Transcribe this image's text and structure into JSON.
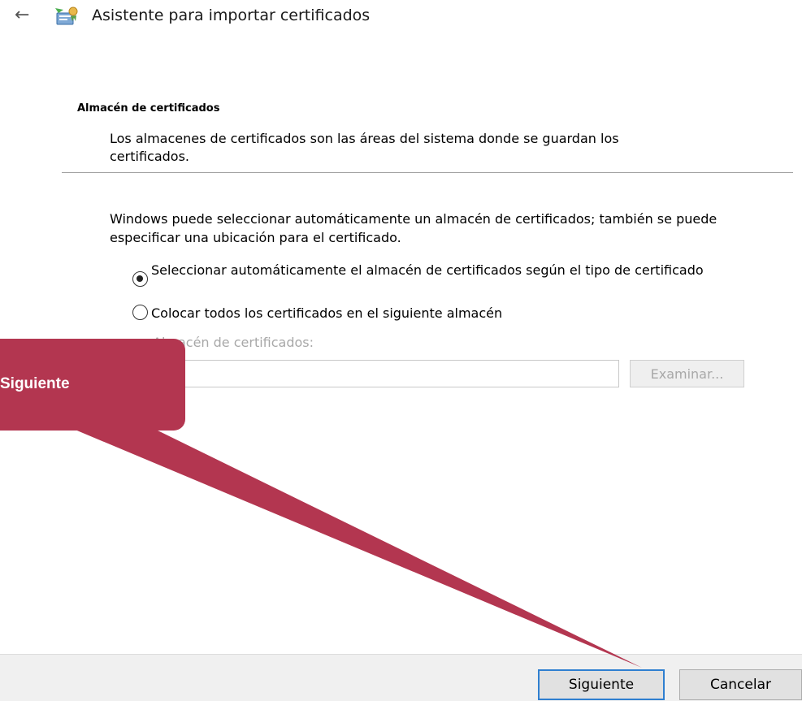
{
  "window": {
    "title": "Asistente para importar certificados",
    "back_icon": "back-arrow-icon",
    "app_icon": "certificate-wizard-icon"
  },
  "section": {
    "title": "Almacén de certificados",
    "description": "Los almacenes de certificados son las áreas del sistema donde se guardan los certificados."
  },
  "intro": "Windows puede seleccionar automáticamente un almacén de certificados; también se puede especificar una ubicación para el certificado.",
  "options": [
    {
      "label": "Seleccionar automáticamente el almacén de certificados según el tipo de certificado",
      "selected": true
    },
    {
      "label": "Colocar todos los certificados en el siguiente almacén",
      "selected": false
    }
  ],
  "store": {
    "label": "Almacén de certificados:",
    "value": "",
    "browse_label": "Examinar..."
  },
  "footer": {
    "next_label": "Siguiente",
    "cancel_label": "Cancelar"
  },
  "callout": {
    "text": "Siguiente",
    "color": "#b33650"
  }
}
